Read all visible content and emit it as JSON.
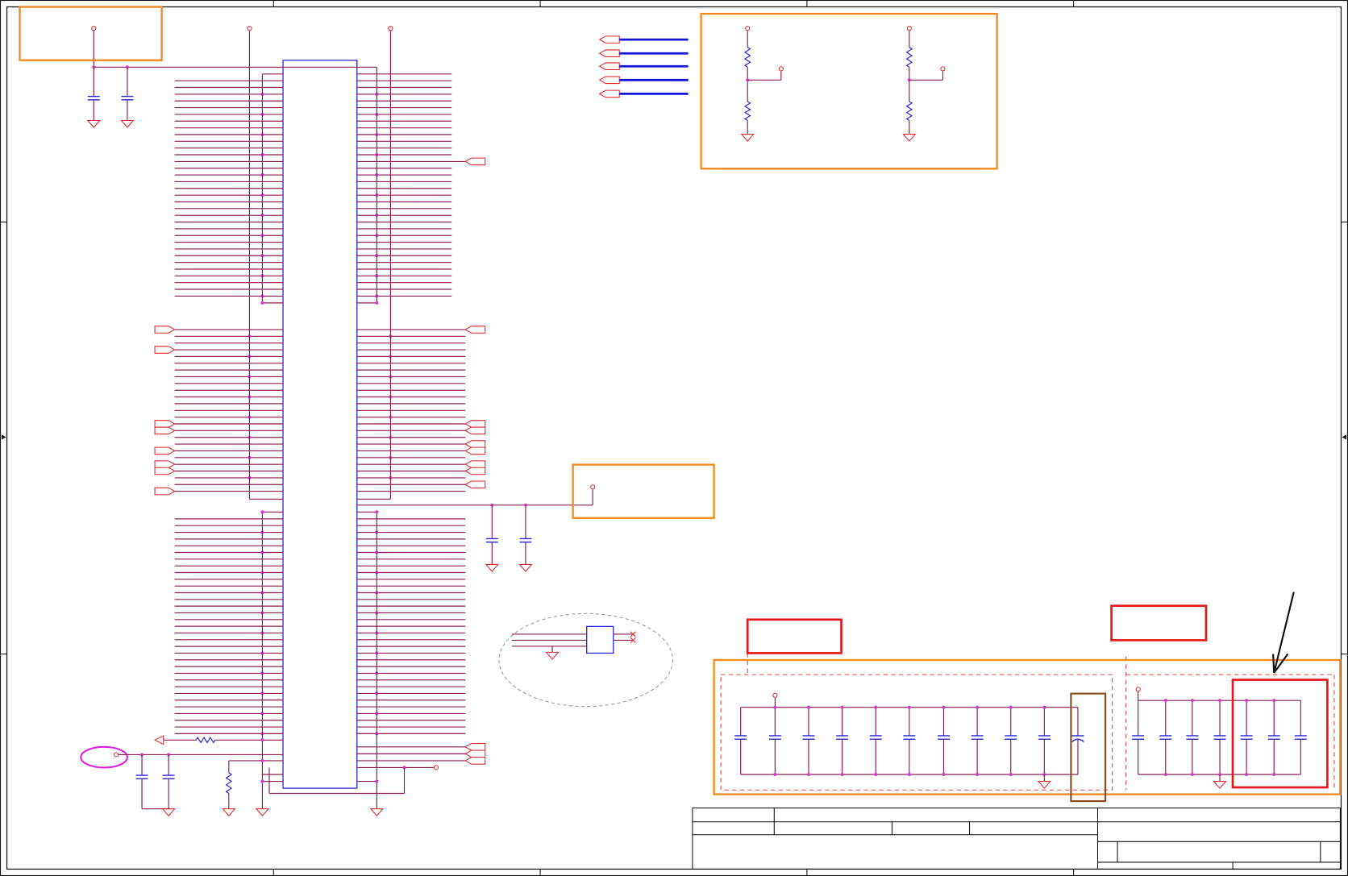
{
  "colors": {
    "wire": "#8b1c55",
    "symbol": "#e0282c",
    "part": "#2424d8",
    "junction": "#d23ad2",
    "net_bus": "#1414d8",
    "highlight_box": "#f28a1c",
    "alert_box": "#e41818",
    "polarized_cap_box": "#8a4a1c",
    "dashed_group": "#e04040",
    "dashed_ellipse": "#9a9a9a",
    "callout_ellipse": "#e21ee2",
    "frame": "#111111"
  }
}
